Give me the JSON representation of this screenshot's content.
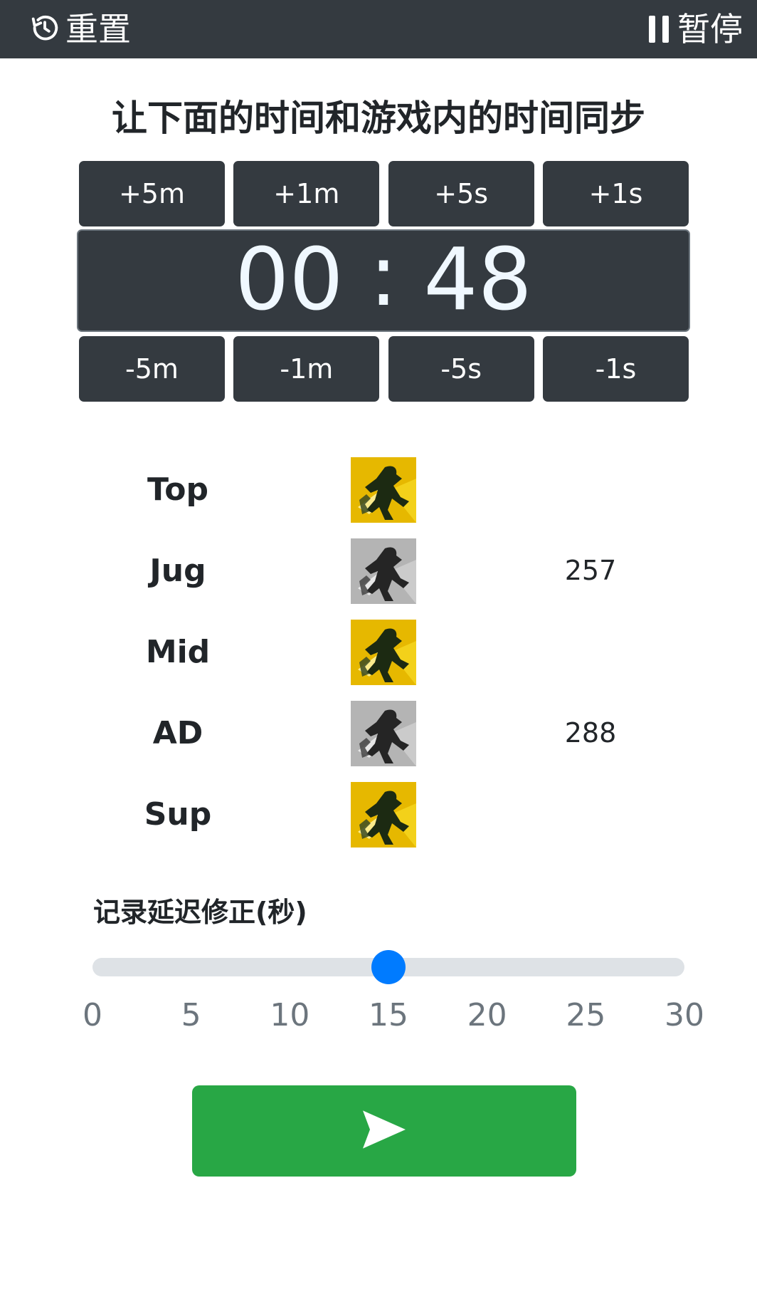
{
  "topbar": {
    "reset_label": "重置",
    "pause_label": "暂停",
    "reset_icon": "history-icon",
    "pause_icon": "pause-icon"
  },
  "title": "让下面的时间和游戏内的时间同步",
  "timer": {
    "minutes": "00",
    "separator": ":",
    "seconds": "48",
    "plus_buttons": [
      "+5m",
      "+1m",
      "+5s",
      "+1s"
    ],
    "minus_buttons": [
      "-5m",
      "-1m",
      "-5s",
      "-1s"
    ]
  },
  "players": [
    {
      "role": "Top",
      "icon": "flash-icon",
      "state": "ready",
      "cooldown": ""
    },
    {
      "role": "Jug",
      "icon": "flash-icon",
      "state": "cooldown",
      "cooldown": "257"
    },
    {
      "role": "Mid",
      "icon": "flash-icon",
      "state": "ready",
      "cooldown": ""
    },
    {
      "role": "AD",
      "icon": "flash-icon",
      "state": "cooldown",
      "cooldown": "288"
    },
    {
      "role": "Sup",
      "icon": "flash-icon",
      "state": "ready",
      "cooldown": ""
    }
  ],
  "delay": {
    "label": "记录延迟修正(秒)",
    "value": 15,
    "min": 0,
    "max": 30,
    "ticks": [
      "0",
      "5",
      "10",
      "15",
      "20",
      "25",
      "30"
    ]
  },
  "send": {
    "icon": "send-icon"
  },
  "colors": {
    "topbar": "#343a40",
    "button": "#343a40",
    "slider_thumb": "#007bff",
    "slider_track": "#dee2e6",
    "send": "#28a745",
    "clock_text": "#f0f8ff"
  }
}
